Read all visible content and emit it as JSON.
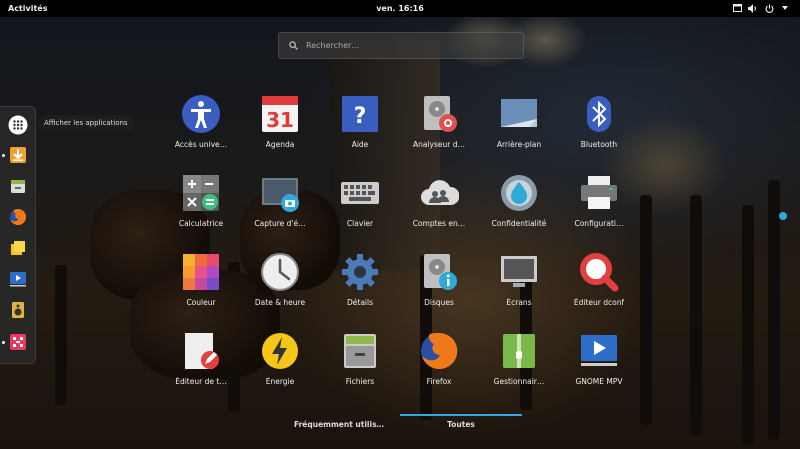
{
  "topbar": {
    "activities": "Activités",
    "clock": "ven. 16:16",
    "tray_icons": [
      "window-icon",
      "volume-icon",
      "power-icon"
    ]
  },
  "search": {
    "placeholder": "Rechercher…"
  },
  "dash": {
    "tooltip": "Afficher les applications",
    "items": [
      {
        "name": "show-apps-icon"
      },
      {
        "name": "downloader-icon",
        "running": true
      },
      {
        "name": "files-drawer-icon"
      },
      {
        "name": "firefox-icon"
      },
      {
        "name": "notes-icon"
      },
      {
        "name": "video-player-icon"
      },
      {
        "name": "speaker-icon"
      },
      {
        "name": "game-icon",
        "running": true
      }
    ]
  },
  "apps": [
    {
      "label": "Accès unive…",
      "icon": "accessibility-icon"
    },
    {
      "label": "Agenda",
      "icon": "calendar-icon",
      "day": "31"
    },
    {
      "label": "Aide",
      "icon": "help-icon"
    },
    {
      "label": "Analyseur d…",
      "icon": "disk-usage-icon"
    },
    {
      "label": "Arrière-plan",
      "icon": "background-icon"
    },
    {
      "label": "Bluetooth",
      "icon": "bluetooth-icon"
    },
    {
      "label": "Calculatrice",
      "icon": "calculator-icon"
    },
    {
      "label": "Capture d'é…",
      "icon": "screenshot-icon"
    },
    {
      "label": "Clavier",
      "icon": "keyboard-icon"
    },
    {
      "label": "Comptes en…",
      "icon": "online-accounts-icon"
    },
    {
      "label": "Confidentialité",
      "icon": "privacy-icon"
    },
    {
      "label": "Configurati…",
      "icon": "printer-icon"
    },
    {
      "label": "Couleur",
      "icon": "color-icon"
    },
    {
      "label": "Date & heure",
      "icon": "clock-icon"
    },
    {
      "label": "Détails",
      "icon": "details-gear-icon"
    },
    {
      "label": "Disques",
      "icon": "disks-icon"
    },
    {
      "label": "Écrans",
      "icon": "displays-icon"
    },
    {
      "label": "Éditeur dconf",
      "icon": "dconf-icon"
    },
    {
      "label": "Éditeur de t…",
      "icon": "text-editor-icon"
    },
    {
      "label": "Énergie",
      "icon": "power-energy-icon"
    },
    {
      "label": "Fichiers",
      "icon": "files-icon"
    },
    {
      "label": "Firefox",
      "icon": "firefox-icon"
    },
    {
      "label": "Gestionnair…",
      "icon": "archive-manager-icon"
    },
    {
      "label": "GNOME MPV",
      "icon": "mpv-icon"
    }
  ],
  "switcher": {
    "frequent": "Fréquemment utilis…",
    "all": "Toutes",
    "active": "all"
  }
}
